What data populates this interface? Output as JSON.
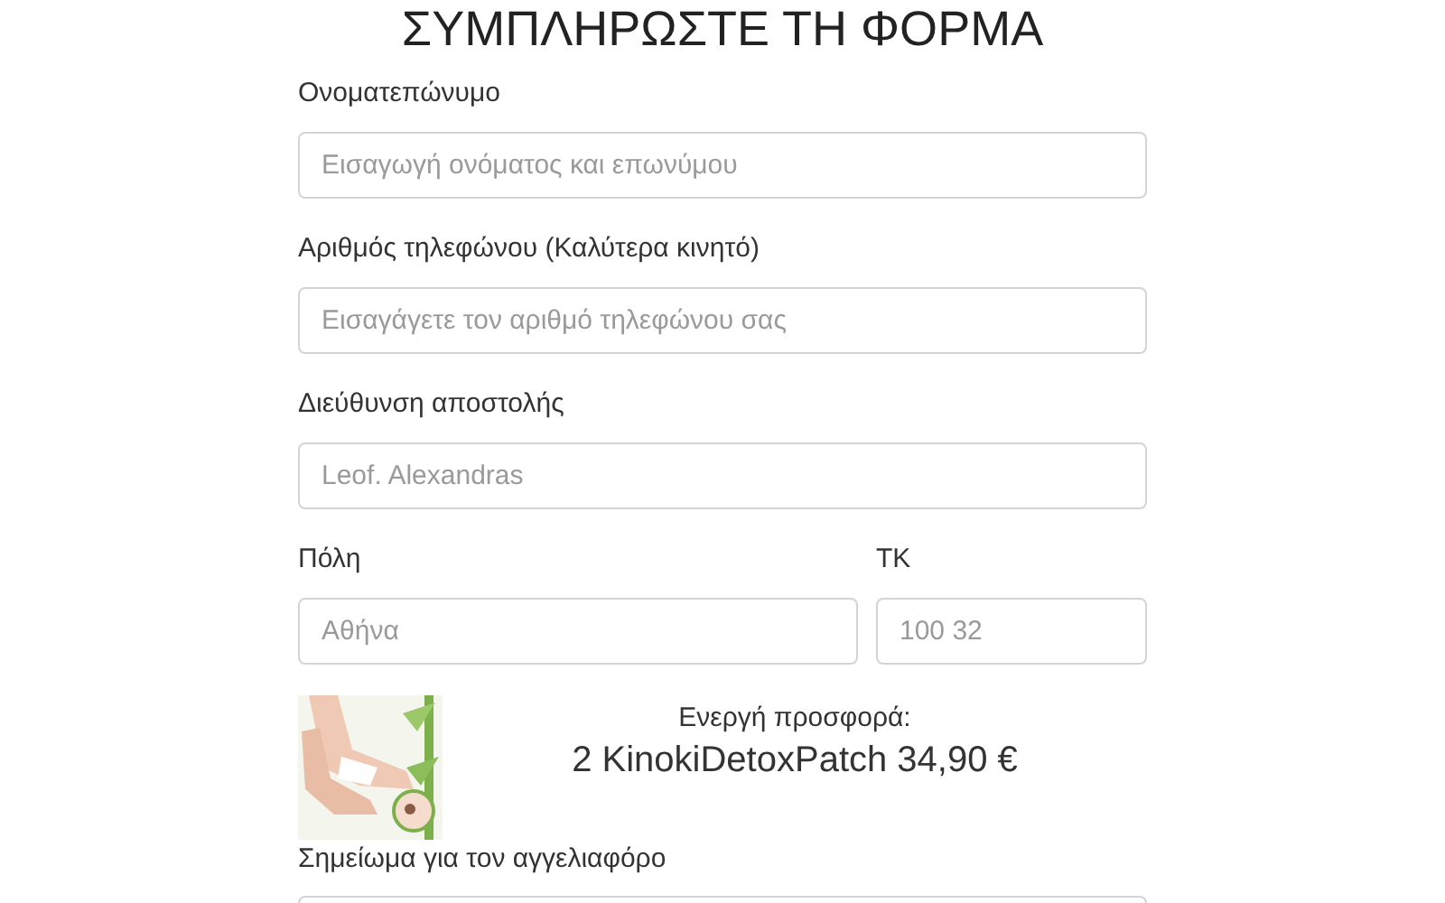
{
  "title": "ΣΥΜΠΛΗΡΩΣΤΕ ΤΗ ΦΟΡΜΑ",
  "fields": [
    {
      "label": "Ονοματεπώνυμο",
      "placeholder": "Εισαγωγή ονόματος και επωνύμου"
    },
    {
      "label": "Αριθμός τηλεφώνου (Καλύτερα κινητό)",
      "placeholder": "Εισαγάγετε τον αριθμό τηλεφώνου σας"
    },
    {
      "label": "Διεύθυνση αποστολής",
      "placeholder": "Leof. Alexandras"
    }
  ],
  "row_fields": [
    {
      "label": "Πόλη",
      "placeholder": "Αθήνα"
    },
    {
      "label": "ΤΚ",
      "placeholder": "100 32"
    }
  ],
  "offer": {
    "label": "Ενεργή προσφορά:",
    "product": "2 KinokiDetoxPatch 34,90 €"
  },
  "note": {
    "label": "Σημείωμα για τον αγγελιαφόρο"
  }
}
